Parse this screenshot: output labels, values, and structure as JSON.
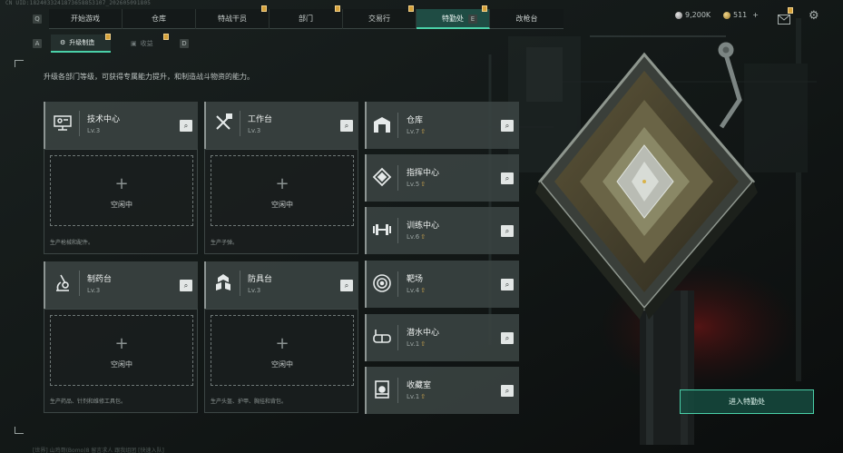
{
  "uid_text": "CN UID:1824033241873658853107_202605091805",
  "nav": {
    "left_key": "Q",
    "right_key": "E",
    "tabs": [
      {
        "label": "开始游戏",
        "badge": false
      },
      {
        "label": "仓库",
        "badge": false
      },
      {
        "label": "特战干员",
        "badge": true
      },
      {
        "label": "部门",
        "badge": true
      },
      {
        "label": "交易行",
        "badge": true
      },
      {
        "label": "特勤处",
        "badge": true,
        "active": true
      },
      {
        "label": "改枪台",
        "badge": false
      }
    ]
  },
  "resources": {
    "silver": "9,200K",
    "gold": "511"
  },
  "subtabs": {
    "left_key": "A",
    "right_key": "D",
    "upgrade_label": "升级制造",
    "other_label": "收益"
  },
  "description": "升级各部门等级，可获得专属能力提升，和制造战斗物资的能力。",
  "workshops": [
    {
      "name": "技术中心",
      "level": "Lv.3",
      "icon": "computer-icon",
      "slot_label": "空闲中",
      "desc": "生产枪械和配件。"
    },
    {
      "name": "工作台",
      "level": "Lv.3",
      "icon": "tools-icon",
      "slot_label": "空闲中",
      "desc": "生产子弹。"
    },
    {
      "name": "制药台",
      "level": "Lv.3",
      "icon": "microscope-icon",
      "slot_label": "空闲中",
      "desc": "生产药品、针剂和维修工具包。"
    },
    {
      "name": "防具台",
      "level": "Lv.3",
      "icon": "armor-icon",
      "slot_label": "空闲中",
      "desc": "生产头盔、护甲、胸挂和背包。"
    }
  ],
  "facilities": [
    {
      "name": "仓库",
      "level": "Lv.7",
      "icon": "warehouse-icon"
    },
    {
      "name": "指挥中心",
      "level": "Lv.5",
      "icon": "command-icon"
    },
    {
      "name": "训练中心",
      "level": "Lv.6",
      "icon": "dumbbell-icon"
    },
    {
      "name": "靶场",
      "level": "Lv.4",
      "icon": "target-icon"
    },
    {
      "name": "潜水中心",
      "level": "Lv.1",
      "icon": "diving-mask-icon"
    },
    {
      "name": "收藏室",
      "level": "Lv.1",
      "icon": "collection-icon"
    }
  ],
  "level_up_arrow": "⇧",
  "enter_button": "进入特勤处",
  "search_icon": "search-icon",
  "chat_line": "[世界] 山鸡哥(Bomo)8  留言求人  跟我组团  [快速入队]",
  "colors": {
    "accent": "#4ad0a8",
    "badge": "#d6a23a",
    "active_tab": "#1f4c44"
  }
}
